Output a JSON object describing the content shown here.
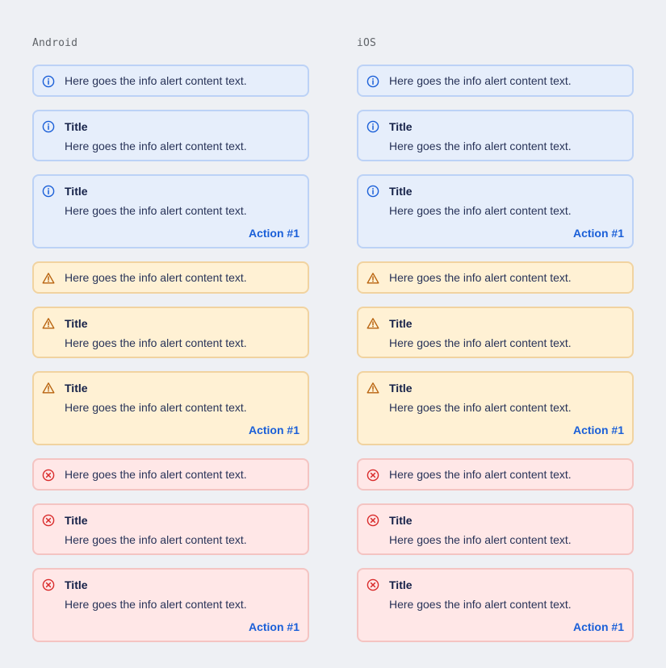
{
  "columns": [
    {
      "label": "Android",
      "alerts": [
        {
          "variant": "info",
          "icon": "info-icon",
          "text": "Here goes the info alert content text."
        },
        {
          "variant": "info",
          "icon": "info-icon",
          "title": "Title",
          "text": "Here goes the info alert content text."
        },
        {
          "variant": "info",
          "icon": "info-icon",
          "title": "Title",
          "text": "Here goes the info alert content text.",
          "action": "Action #1"
        },
        {
          "variant": "warning",
          "icon": "warning-icon",
          "text": "Here goes the info alert content text."
        },
        {
          "variant": "warning",
          "icon": "warning-icon",
          "title": "Title",
          "text": "Here goes the info alert content text."
        },
        {
          "variant": "warning",
          "icon": "warning-icon",
          "title": "Title",
          "text": "Here goes the info alert content text.",
          "action": "Action #1"
        },
        {
          "variant": "error",
          "icon": "error-icon",
          "text": "Here goes the info alert content text."
        },
        {
          "variant": "error",
          "icon": "error-icon",
          "title": "Title",
          "text": "Here goes the info alert content text."
        },
        {
          "variant": "error",
          "icon": "error-icon",
          "title": "Title",
          "text": "Here goes the info alert content text.",
          "action": "Action #1"
        }
      ]
    },
    {
      "label": "iOS",
      "alerts": [
        {
          "variant": "info",
          "icon": "info-icon",
          "text": "Here goes the info alert content text."
        },
        {
          "variant": "info",
          "icon": "info-icon",
          "title": "Title",
          "text": "Here goes the info alert content text."
        },
        {
          "variant": "info",
          "icon": "info-icon",
          "title": "Title",
          "text": "Here goes the info alert content text.",
          "action": "Action #1"
        },
        {
          "variant": "warning",
          "icon": "warning-icon",
          "text": "Here goes the info alert content text."
        },
        {
          "variant": "warning",
          "icon": "warning-icon",
          "title": "Title",
          "text": "Here goes the info alert content text."
        },
        {
          "variant": "warning",
          "icon": "warning-icon",
          "title": "Title",
          "text": "Here goes the info alert content text.",
          "action": "Action #1"
        },
        {
          "variant": "error",
          "icon": "error-icon",
          "text": "Here goes the info alert content text."
        },
        {
          "variant": "error",
          "icon": "error-icon",
          "title": "Title",
          "text": "Here goes the info alert content text."
        },
        {
          "variant": "error",
          "icon": "error-icon",
          "title": "Title",
          "text": "Here goes the info alert content text.",
          "action": "Action #1"
        }
      ]
    }
  ],
  "colors": {
    "info": "#1a5fd8",
    "warning": "#b8630f",
    "error": "#d92b2b",
    "action": "#1a5fd8"
  }
}
